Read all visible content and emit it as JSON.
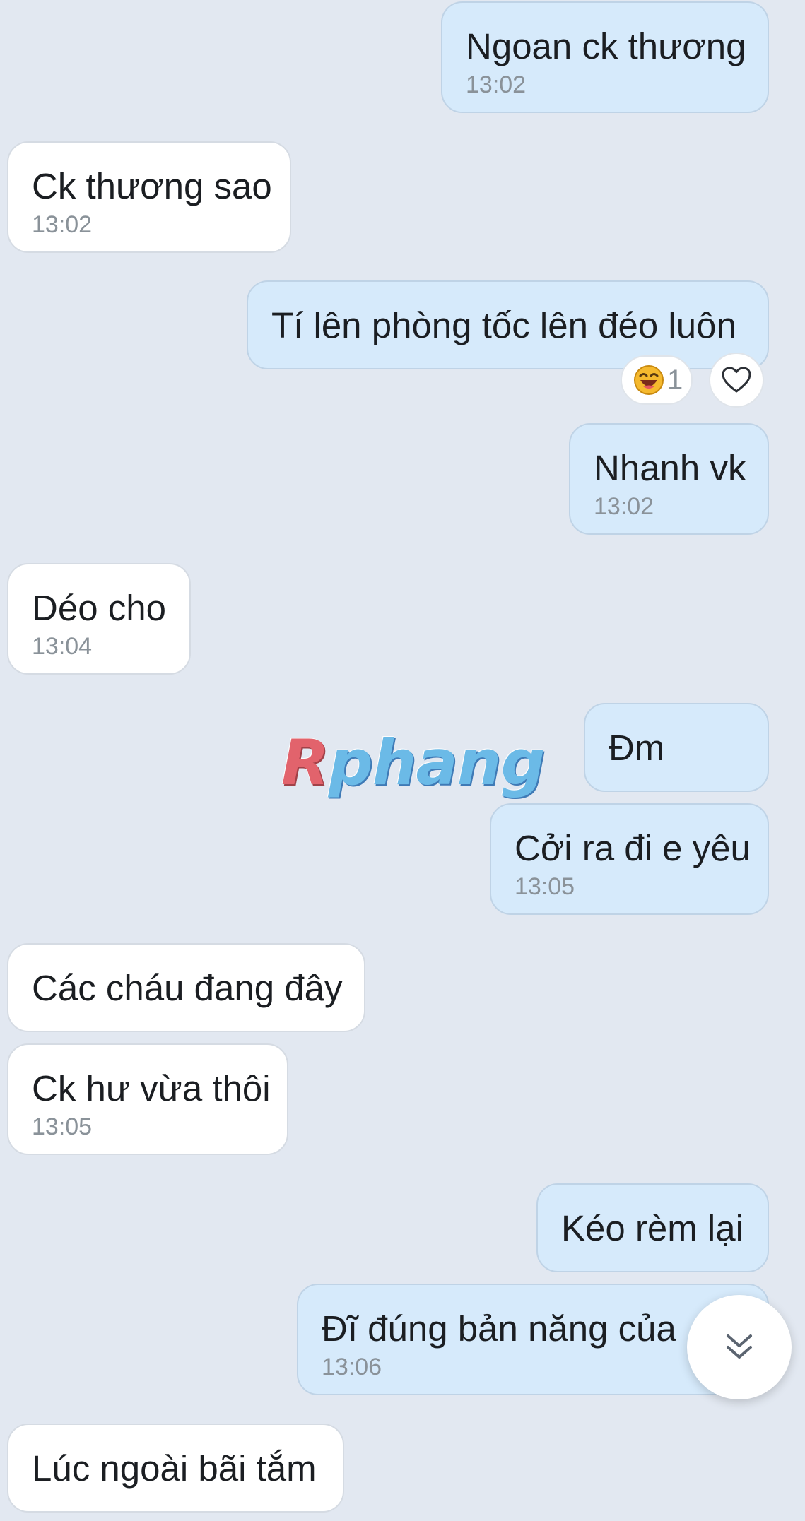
{
  "messages": [
    {
      "side": "out",
      "text": "Ngoan ck thương",
      "time": "13:02"
    },
    {
      "side": "in",
      "text": "Ck thương sao",
      "time": "13:02"
    },
    {
      "side": "out",
      "text": "Tí lên phòng tốc lên đéo luôn",
      "time": ""
    },
    {
      "side": "out",
      "text": "Nhanh vk",
      "time": "13:02"
    },
    {
      "side": "in",
      "text": "Déo cho",
      "time": "13:04"
    },
    {
      "side": "out",
      "text": "Đm",
      "time": ""
    },
    {
      "side": "out",
      "text": "Cởi ra đi e yêu",
      "time": "13:05"
    },
    {
      "side": "in",
      "text": "Các cháu đang đây",
      "time": ""
    },
    {
      "side": "in",
      "text": "Ck hư vừa thôi",
      "time": "13:05"
    },
    {
      "side": "out",
      "text": "Kéo rèm lại",
      "time": ""
    },
    {
      "side": "out",
      "text": "Đĩ đúng bản năng của",
      "time": "13:06"
    },
    {
      "side": "in",
      "text": "Lúc ngoài bãi tắm",
      "time": ""
    }
  ],
  "reaction": {
    "emoji": "laughing-emoji",
    "count": "1"
  },
  "watermark": {
    "first_letter": "R",
    "rest": "phang"
  },
  "icons": {
    "heart": "heart-outline-icon",
    "scroll_down": "chevron-double-down-icon"
  },
  "colors": {
    "background": "#e2e8f1",
    "incoming_bubble": "#ffffff",
    "outgoing_bubble": "#d6eafb",
    "timestamp": "#8a9299"
  }
}
